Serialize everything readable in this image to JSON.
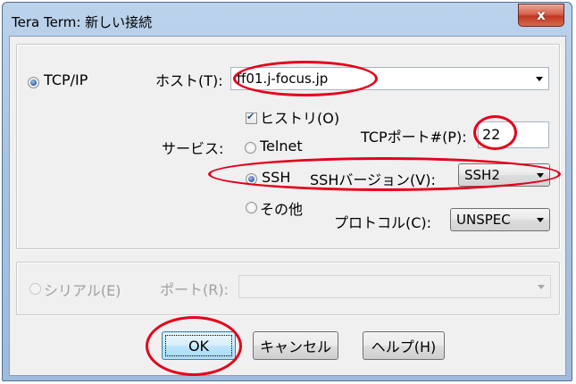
{
  "window": {
    "title": "Tera Term: 新しい接続",
    "close_glyph": "x"
  },
  "tcpip": {
    "radio_label": "TCP/IP",
    "selected": true,
    "host_label": "ホスト(T):",
    "host_value": "ff01.j-focus.jp",
    "history_label": "ヒストリ(O)",
    "history_checked": true,
    "service_label": "サービス:",
    "telnet_label": "Telnet",
    "ssh_label": "SSH",
    "other_label": "その他",
    "tcp_port_label": "TCPポート#(P):",
    "tcp_port_value": "22",
    "ssh_version_label": "SSHバージョン(V):",
    "ssh_version_value": "SSH2",
    "protocol_label": "プロトコル(C):",
    "protocol_value": "UNSPEC",
    "selected_service": "SSH"
  },
  "serial": {
    "radio_label": "シリアル(E)",
    "port_label": "ポート(R):",
    "port_value": "",
    "enabled": false
  },
  "buttons": {
    "ok": "OK",
    "cancel": "キャンセル",
    "help": "ヘルプ(H)"
  },
  "colors": {
    "annotation": "#e3001b",
    "titlebar": "#a9c3e2",
    "close_button": "#c0391f",
    "default_button": "#bee6fd"
  }
}
